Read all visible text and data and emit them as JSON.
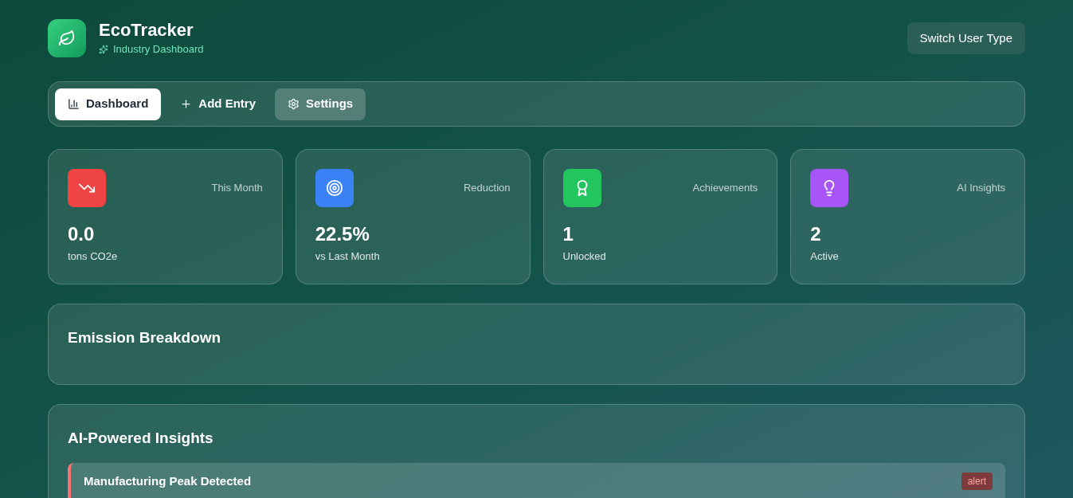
{
  "header": {
    "title": "EcoTracker",
    "subtitle": "Industry Dashboard",
    "button": "Switch User Type"
  },
  "tabs": [
    {
      "label": "Dashboard",
      "selected": true,
      "hovered": false
    },
    {
      "label": "Add Entry",
      "selected": false,
      "hovered": false
    },
    {
      "label": "Settings",
      "selected": false,
      "hovered": true
    }
  ],
  "stats": [
    {
      "label": "This Month",
      "value": "0.0",
      "unit": "tons CO2e",
      "color": "#ef4444"
    },
    {
      "label": "Reduction",
      "value": "22.5%",
      "unit": "vs Last Month",
      "color": "#3b82f6"
    },
    {
      "label": "Achievements",
      "value": "1",
      "unit": "Unlocked",
      "color": "#22c55e"
    },
    {
      "label": "AI Insights",
      "value": "2",
      "unit": "Active",
      "color": "#a855f7"
    }
  ],
  "emission_breakdown": {
    "title": "Emission Breakdown"
  },
  "insights": {
    "title": "AI-Powered Insights",
    "items": [
      {
        "title": "Manufacturing Peak Detected",
        "badge": "alert",
        "color": "#f87171"
      }
    ]
  }
}
